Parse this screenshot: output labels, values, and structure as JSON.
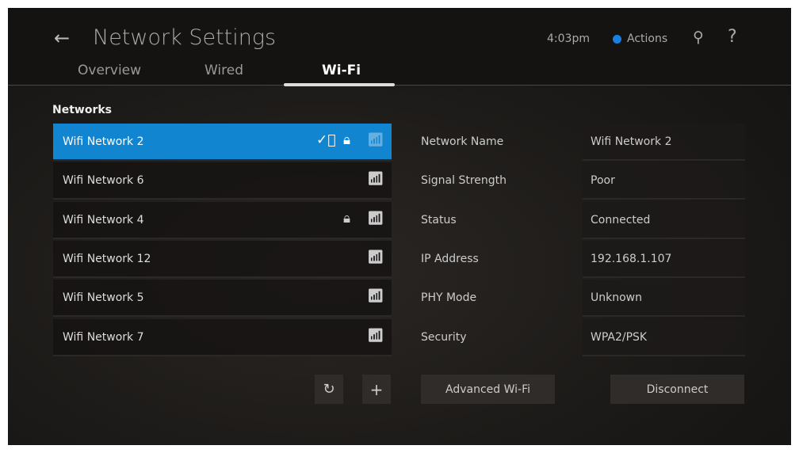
{
  "header": {
    "title": "Network Settings",
    "time": "4:03pm",
    "actions": "Actions"
  },
  "tabs": [
    "Overview",
    "Wired",
    "Wi-Fi"
  ],
  "networks_label": "Networks",
  "networks": [
    {
      "name": "Wifi Network 2",
      "connected": true,
      "locked": true,
      "selected": true
    },
    {
      "name": "Wifi Network 6",
      "connected": false,
      "locked": false
    },
    {
      "name": "Wifi Network 4",
      "connected": false,
      "locked": true
    },
    {
      "name": "Wifi Network 12",
      "connected": false,
      "locked": false
    },
    {
      "name": "Wifi Network 5",
      "connected": false,
      "locked": false
    },
    {
      "name": "Wifi Network 7",
      "connected": false,
      "locked": false
    }
  ],
  "details": [
    {
      "label": "Network Name",
      "value": "Wifi Network 2"
    },
    {
      "label": "Signal Strength",
      "value": "Poor"
    },
    {
      "label": "Status",
      "value": "Connected"
    },
    {
      "label": "IP Address",
      "value": "192.168.1.107"
    },
    {
      "label": "PHY Mode",
      "value": "Unknown"
    },
    {
      "label": "Security",
      "value": "WPA2/PSK"
    }
  ],
  "buttons": {
    "advanced": "Advanced Wi-Fi",
    "disconnect": "Disconnect"
  },
  "colors": {
    "accent": "#1285d1"
  }
}
